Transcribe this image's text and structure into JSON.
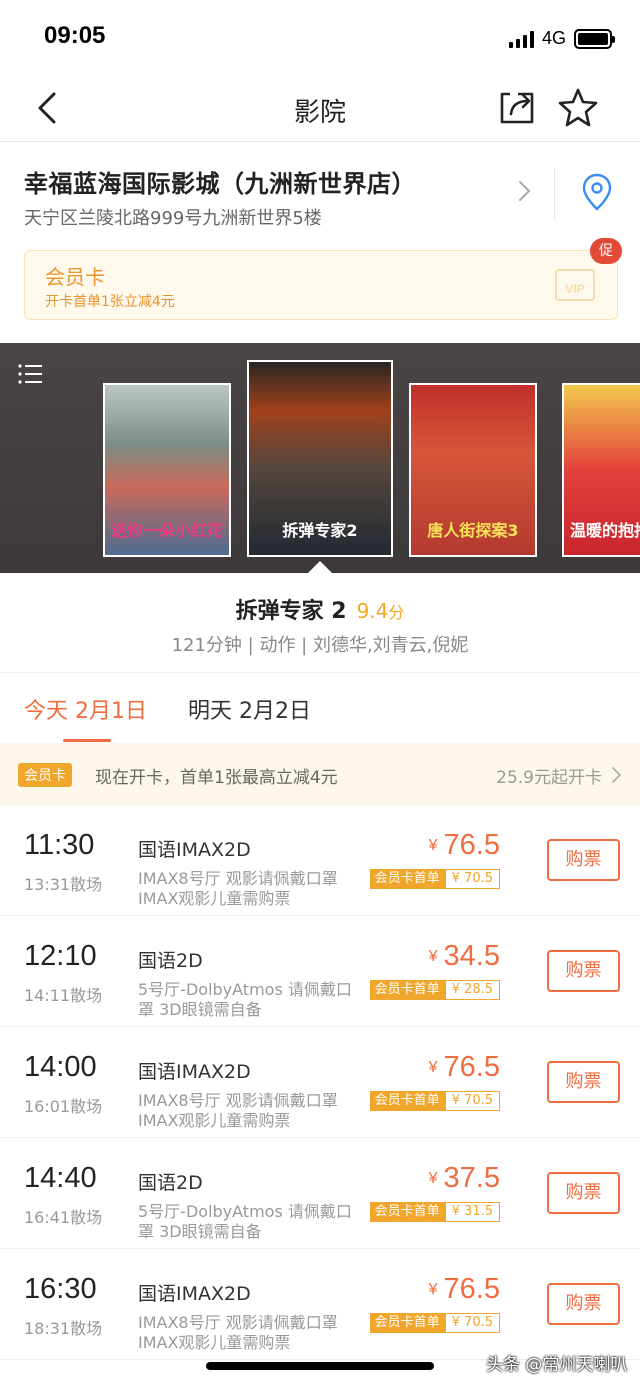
{
  "status_bar": {
    "time": "09:05",
    "network": "4G"
  },
  "nav": {
    "title": "影院"
  },
  "cinema": {
    "name": "幸福蓝海国际影城（九洲新世界店）",
    "address": "天宁区兰陵北路999号九洲新世界5楼"
  },
  "member_card": {
    "title": "会员卡",
    "subtitle": "开卡首单1张立减4元",
    "vip_label": "VIP",
    "promo_badge": "促"
  },
  "posters": [
    {
      "caption": "送你一朵小红花"
    },
    {
      "caption": "拆弹专家2"
    },
    {
      "caption": "唐人街探案3"
    },
    {
      "caption": "温暖的抱抱"
    }
  ],
  "movie": {
    "title": "拆弹专家 2",
    "score": "9.4",
    "score_unit": "分",
    "meta": "121分钟 | 动作 | 刘德华,刘青云,倪妮"
  },
  "date_tabs": {
    "today": "今天 2月1日",
    "tomorrow": "明天 2月2日"
  },
  "member_promo": {
    "tag": "会员卡",
    "text": "现在开卡，首单1张最高立减4元",
    "price": "25.9元起开卡"
  },
  "showtimes": [
    {
      "start": "11:30",
      "end": "13:31散场",
      "lang": "国语IMAX2D",
      "hall": "IMAX8号厅 观影请佩戴口罩 IMAX观影儿童需购票",
      "price": "76.5",
      "member_label": "会员卡首单",
      "member_price": "¥ 70.5",
      "buy": "购票"
    },
    {
      "start": "12:10",
      "end": "14:11散场",
      "lang": "国语2D",
      "hall": "5号厅-DolbyAtmos 请佩戴口罩 3D眼镜需自备",
      "price": "34.5",
      "member_label": "会员卡首单",
      "member_price": "¥ 28.5",
      "buy": "购票"
    },
    {
      "start": "14:00",
      "end": "16:01散场",
      "lang": "国语IMAX2D",
      "hall": "IMAX8号厅 观影请佩戴口罩 IMAX观影儿童需购票",
      "price": "76.5",
      "member_label": "会员卡首单",
      "member_price": "¥ 70.5",
      "buy": "购票"
    },
    {
      "start": "14:40",
      "end": "16:41散场",
      "lang": "国语2D",
      "hall": "5号厅-DolbyAtmos 请佩戴口罩 3D眼镜需自备",
      "price": "37.5",
      "member_label": "会员卡首单",
      "member_price": "¥ 31.5",
      "buy": "购票"
    },
    {
      "start": "16:30",
      "end": "18:31散场",
      "lang": "国语IMAX2D",
      "hall": "IMAX8号厅 观影请佩戴口罩 IMAX观影儿童需购票",
      "price": "76.5",
      "member_label": "会员卡首单",
      "member_price": "¥ 70.5",
      "buy": "购票"
    }
  ],
  "currency_symbol": "¥",
  "watermark": "头条 @常州天喇叭",
  "colors": {
    "accent": "#f06d3f",
    "gold": "#f0a52b",
    "location": "#3b8ef0"
  }
}
